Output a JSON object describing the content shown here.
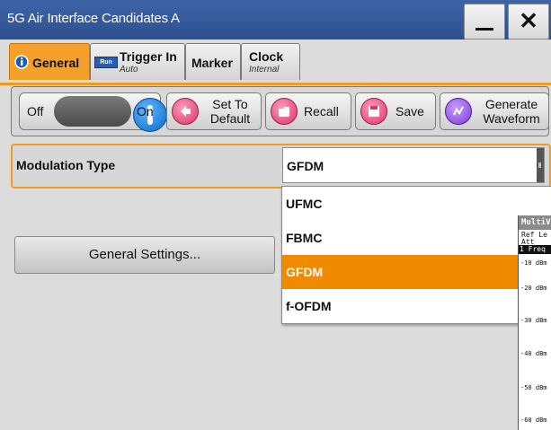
{
  "window": {
    "title": "5G Air Interface Candidates A",
    "minimize_icon": "minimize-icon",
    "close_symbol": "✕"
  },
  "tabs": [
    {
      "label": "General",
      "sub": "",
      "icon": "info-icon",
      "active": true
    },
    {
      "label": "Trigger In",
      "sub": "Auto",
      "icon": "run-icon",
      "badge": "Run",
      "active": false
    },
    {
      "label": "Marker",
      "sub": "",
      "active": false
    },
    {
      "label": "Clock",
      "sub": "Internal",
      "active": false
    }
  ],
  "toolbar": {
    "toggle": {
      "off_label": "Off",
      "on_label": "On",
      "state": "on"
    },
    "set_to_default": "Set To Default",
    "recall": "Recall",
    "save": "Save",
    "generate_waveform": "Generate Waveform"
  },
  "modulation": {
    "label": "Modulation Type",
    "value": "GFDM",
    "options": [
      "UFMC",
      "FBMC",
      "GFDM",
      "f-OFDM"
    ],
    "selected": "GFDM"
  },
  "general_settings_button": "General Settings...",
  "analyzer": {
    "title": "MultiV",
    "ref_level": "Ref Le",
    "att": "Att",
    "freq_label": "1 Freq",
    "db_labels": [
      "-10 dBm",
      "-20 dBm",
      "-30 dBm",
      "-40 dBm",
      "-50 dBm",
      "-60 dBm"
    ]
  },
  "colors": {
    "accent": "#f39a1e",
    "title_bar": "#3e64a8",
    "selected_option": "#f08a00",
    "toggle_knob": "#0c67c9",
    "button_icon": "#d9356a"
  }
}
